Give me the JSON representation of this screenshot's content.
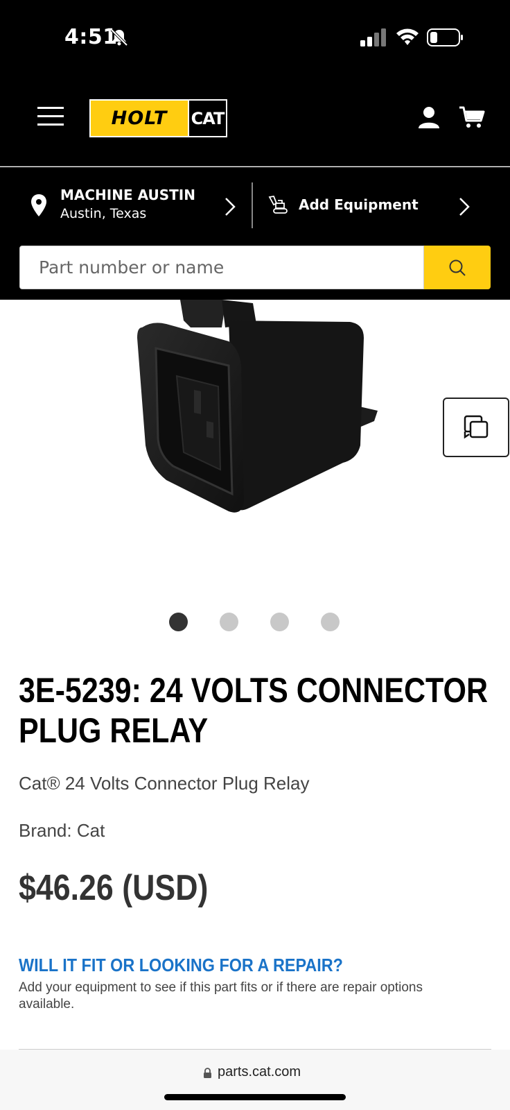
{
  "status_bar": {
    "time": "4:51",
    "icons": [
      "bell-slash-icon",
      "signal-icon",
      "wifi-icon",
      "battery-icon"
    ]
  },
  "header": {
    "logo_left": "HOLT",
    "logo_right": "CAT",
    "icons": [
      "menu-icon",
      "user-icon",
      "cart-icon"
    ],
    "brand_color": "#ffcd11"
  },
  "location": {
    "name": "MACHINE AUSTIN",
    "city": "Austin, Texas",
    "equipment_label": "Add Equipment"
  },
  "search": {
    "placeholder": "Part number or name",
    "button_color": "#ffcd11"
  },
  "carousel": {
    "image_icon": "relay-connector-image",
    "slides": 4,
    "active_slide": 1
  },
  "product": {
    "title": "3E-5239: 24 VOLTS CONNECTOR PLUG RELAY",
    "description": "Cat® 24 Volts Connector Plug Relay",
    "brand": "Brand: Cat",
    "price": "$46.26 (USD)"
  },
  "fit": {
    "heading": "WILL IT FIT OR LOOKING FOR A REPAIR?",
    "text": "Add your equipment to see if this part fits or if there are repair options available.",
    "heading_color": "#1a73c8"
  },
  "browser": {
    "url": "parts.cat.com"
  }
}
